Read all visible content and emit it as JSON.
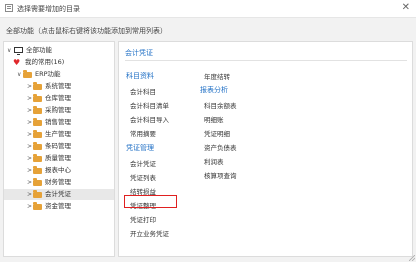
{
  "window": {
    "title": "选择需要增加的目录",
    "close_glyph": "✕"
  },
  "hint": "全部功能（点击鼠标右键将该功能添加到常用列表）",
  "tree": {
    "root": {
      "label": "全部功能",
      "caret": "∨"
    },
    "favorites": {
      "label": "我的常用(16)"
    },
    "erp": {
      "label": "ERP功能",
      "caret": "∨"
    },
    "items": [
      {
        "label": "系统管理",
        "caret": ">"
      },
      {
        "label": "仓库管理",
        "caret": ">"
      },
      {
        "label": "采购管理",
        "caret": ">"
      },
      {
        "label": "销售管理",
        "caret": ">"
      },
      {
        "label": "生产管理",
        "caret": ">"
      },
      {
        "label": "条码管理",
        "caret": ">"
      },
      {
        "label": "质量管理",
        "caret": ">"
      },
      {
        "label": "报表中心",
        "caret": ">"
      },
      {
        "label": "财务管理",
        "caret": ">"
      },
      {
        "label": "会计凭证",
        "caret": ">"
      },
      {
        "label": "资金管理",
        "caret": ">"
      }
    ]
  },
  "main": {
    "header": "会计凭证",
    "col1": {
      "group1": {
        "title": "科目资料",
        "items": [
          "会计科目",
          "会计科目清单",
          "会计科目导入",
          "常用摘要"
        ]
      },
      "group2": {
        "title": "凭证管理",
        "items": [
          "会计凭证",
          "凭证列表",
          "结转损益",
          "凭证整理",
          "凭证打印",
          "开立业务凭证"
        ]
      }
    },
    "col2": {
      "top_item": "年度结转",
      "group": {
        "title": "报表分析",
        "items": [
          "科目余额表",
          "明细账",
          "凭证明细",
          "资产负债表",
          "利润表",
          "核算项查询"
        ]
      }
    }
  },
  "colors": {
    "accent": "#1f6fc5",
    "highlight": "#e02020",
    "folder": "#e6a238",
    "heart": "#e0282c"
  }
}
